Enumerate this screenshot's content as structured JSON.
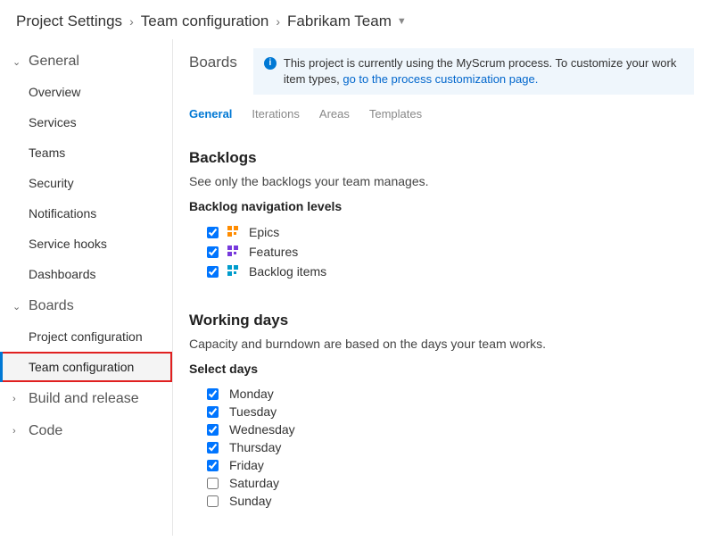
{
  "breadcrumb": {
    "root": "Project Settings",
    "mid": "Team configuration",
    "last": "Fabrikam Team"
  },
  "sidebar": {
    "groups": [
      {
        "label": "General",
        "expanded": true,
        "items": [
          {
            "label": "Overview"
          },
          {
            "label": "Services"
          },
          {
            "label": "Teams"
          },
          {
            "label": "Security"
          },
          {
            "label": "Notifications"
          },
          {
            "label": "Service hooks"
          },
          {
            "label": "Dashboards"
          }
        ]
      },
      {
        "label": "Boards",
        "expanded": true,
        "items": [
          {
            "label": "Project configuration"
          },
          {
            "label": "Team configuration",
            "active": true,
            "highlighted": true
          }
        ]
      },
      {
        "label": "Build and release",
        "expanded": false,
        "items": []
      },
      {
        "label": "Code",
        "expanded": false,
        "items": []
      }
    ]
  },
  "main": {
    "title": "Boards",
    "banner": {
      "text_before_link": "This project is currently using the MyScrum process. To customize your work item types, ",
      "link_text": "go to the process customization page.",
      "text_after_link": ""
    },
    "tabs": [
      {
        "label": "General",
        "active": true
      },
      {
        "label": "Iterations"
      },
      {
        "label": "Areas"
      },
      {
        "label": "Templates"
      }
    ],
    "backlogs": {
      "title": "Backlogs",
      "desc": "See only the backlogs your team manages.",
      "nav_title": "Backlog navigation levels",
      "levels": [
        {
          "label": "Epics",
          "checked": true,
          "icon": "epics"
        },
        {
          "label": "Features",
          "checked": true,
          "icon": "features"
        },
        {
          "label": "Backlog items",
          "checked": true,
          "icon": "backlog"
        }
      ]
    },
    "working_days": {
      "title": "Working days",
      "desc": "Capacity and burndown are based on the days your team works.",
      "select_title": "Select days",
      "days": [
        {
          "label": "Monday",
          "checked": true
        },
        {
          "label": "Tuesday",
          "checked": true
        },
        {
          "label": "Wednesday",
          "checked": true
        },
        {
          "label": "Thursday",
          "checked": true
        },
        {
          "label": "Friday",
          "checked": true
        },
        {
          "label": "Saturday",
          "checked": false
        },
        {
          "label": "Sunday",
          "checked": false
        }
      ]
    }
  }
}
